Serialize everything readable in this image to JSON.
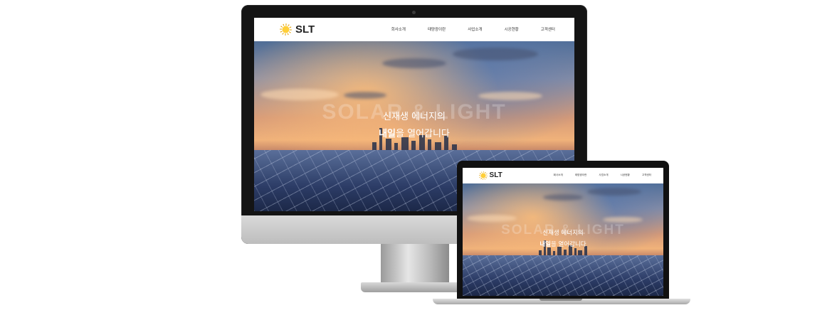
{
  "site": {
    "logo_text": "SLT",
    "nav": [
      "회사소개",
      "태양광이란",
      "사업소개",
      "시공현황",
      "고객센터"
    ],
    "hero_word": "SOLAR & LIGHT",
    "tagline_line1": "신재생 에너지의",
    "tagline_line2_bold": "내일",
    "tagline_line2_rest": "을 열어갑니다"
  },
  "colors": {
    "device_black": "#141414",
    "logo_sun": "#e5a100",
    "sky_top": "#4f6d96",
    "sky_glow": "#f0b27a"
  },
  "icons": [
    "sun-logo-icon"
  ]
}
